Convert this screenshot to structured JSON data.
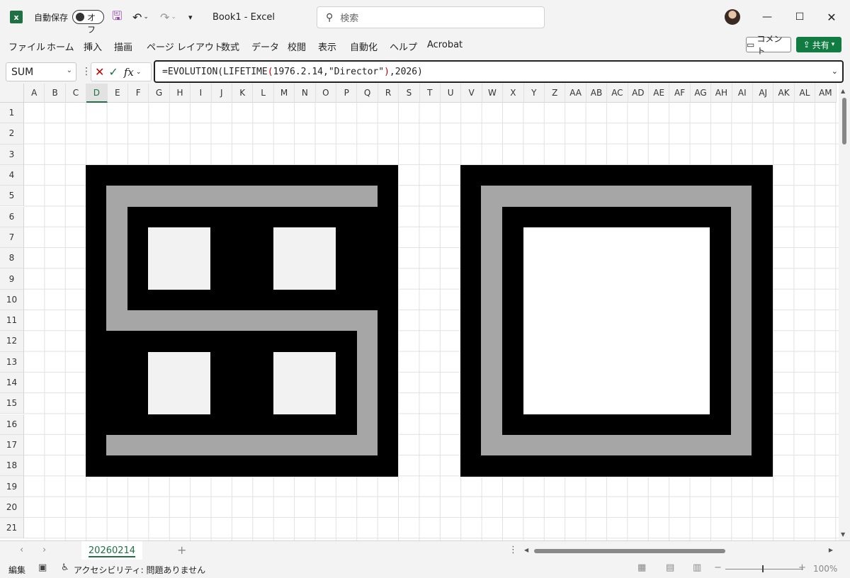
{
  "titlebar": {
    "autosave_label": "自動保存",
    "autosave_state": "オフ",
    "doc_title": "Book1  -  Excel",
    "search_placeholder": "検索"
  },
  "menu": {
    "items": [
      "ファイル",
      "ホーム",
      "挿入",
      "描画",
      "ページ レイアウト",
      "数式",
      "データ",
      "校閲",
      "表示",
      "自動化",
      "ヘルプ",
      "Acrobat"
    ],
    "comment_label": "コメント",
    "share_label": "共有"
  },
  "formula_bar": {
    "name_box": "SUM",
    "fx_label": "fx",
    "formula_part1": "=EVOLUTION(LIFETIME",
    "formula_paren_open": "(",
    "formula_args": "1976.2.14,\"Director\"",
    "formula_paren_close": ")",
    "formula_part2": ",2026)"
  },
  "columns": [
    "A",
    "B",
    "C",
    "D",
    "E",
    "F",
    "G",
    "H",
    "I",
    "J",
    "K",
    "L",
    "M",
    "N",
    "O",
    "P",
    "Q",
    "R",
    "S",
    "T",
    "U",
    "V",
    "W",
    "X",
    "Y",
    "Z",
    "AA",
    "AB",
    "AC",
    "AD",
    "AE",
    "AF",
    "AG",
    "AH",
    "AI",
    "AJ",
    "AK",
    "AL",
    "AM"
  ],
  "selected_column": "D",
  "rows": [
    "1",
    "2",
    "3",
    "4",
    "5",
    "6",
    "7",
    "8",
    "9",
    "10",
    "11",
    "12",
    "13",
    "14",
    "15",
    "16",
    "17",
    "18",
    "19",
    "20",
    "21"
  ],
  "sheet_tab": "20260214",
  "status": {
    "mode": "編集",
    "accessibility": "アクセシビリティ: 問題ありません",
    "zoom": "100%"
  },
  "colors": {
    "excel_green": "#1e7145",
    "pixel_black": "#000000",
    "pixel_gray": "#a6a6a6",
    "pixel_light": "#f2f2f2",
    "formula_paren_red": "#c00000"
  }
}
